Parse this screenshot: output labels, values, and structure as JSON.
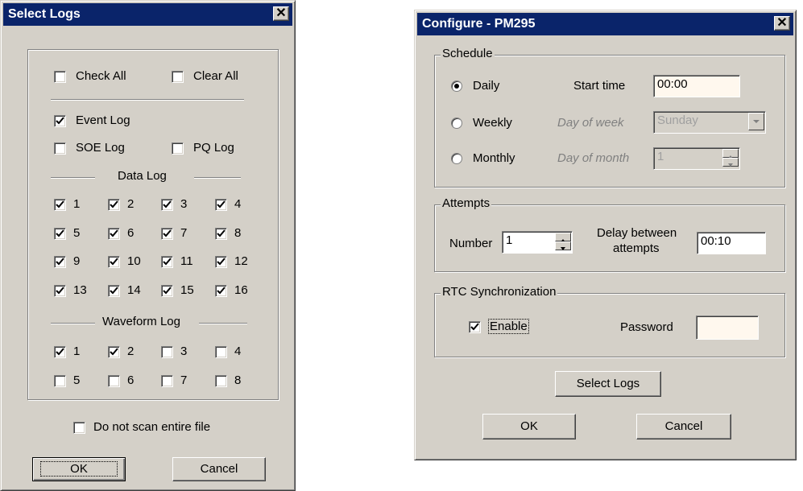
{
  "select_logs": {
    "title": "Select Logs",
    "check_all": {
      "label": "Check All",
      "checked": false
    },
    "clear_all": {
      "label": "Clear All",
      "checked": false
    },
    "event_log": {
      "label": "Event Log",
      "checked": true
    },
    "soe_log": {
      "label": "SOE Log",
      "checked": false
    },
    "pq_log": {
      "label": "PQ Log",
      "checked": false
    },
    "data_log_label": "Data Log",
    "data_logs": [
      {
        "label": "1",
        "checked": true
      },
      {
        "label": "2",
        "checked": true
      },
      {
        "label": "3",
        "checked": true
      },
      {
        "label": "4",
        "checked": true
      },
      {
        "label": "5",
        "checked": true
      },
      {
        "label": "6",
        "checked": true
      },
      {
        "label": "7",
        "checked": true
      },
      {
        "label": "8",
        "checked": true
      },
      {
        "label": "9",
        "checked": true
      },
      {
        "label": "10",
        "checked": true
      },
      {
        "label": "11",
        "checked": true
      },
      {
        "label": "12",
        "checked": true
      },
      {
        "label": "13",
        "checked": true
      },
      {
        "label": "14",
        "checked": true
      },
      {
        "label": "15",
        "checked": true
      },
      {
        "label": "16",
        "checked": true
      }
    ],
    "waveform_log_label": "Waveform Log",
    "waveform_logs": [
      {
        "label": "1",
        "checked": true
      },
      {
        "label": "2",
        "checked": true
      },
      {
        "label": "3",
        "checked": false
      },
      {
        "label": "4",
        "checked": false
      },
      {
        "label": "5",
        "checked": false
      },
      {
        "label": "6",
        "checked": false
      },
      {
        "label": "7",
        "checked": false
      },
      {
        "label": "8",
        "checked": false
      }
    ],
    "no_scan": {
      "label": "Do not scan entire file",
      "checked": false
    },
    "ok_label": "OK",
    "cancel_label": "Cancel"
  },
  "configure": {
    "title": "Configure - PM295",
    "schedule": {
      "group_label": "Schedule",
      "daily_label": "Daily",
      "weekly_label": "Weekly",
      "monthly_label": "Monthly",
      "selected": "Daily",
      "start_time_label": "Start time",
      "start_time_value": "00:00",
      "day_of_week_label": "Day of week",
      "day_of_week_value": "Sunday",
      "day_of_month_label": "Day of month",
      "day_of_month_value": "1"
    },
    "attempts": {
      "group_label": "Attempts",
      "number_label": "Number",
      "number_value": "1",
      "delay_label_line1": "Delay between",
      "delay_label_line2": "attempts",
      "delay_value": "00:10"
    },
    "rtc": {
      "group_label": "RTC Synchronization",
      "enable_label": "Enable",
      "enable_checked": true,
      "password_label": "Password",
      "password_value": ""
    },
    "select_logs_label": "Select Logs",
    "ok_label": "OK",
    "cancel_label": "Cancel"
  }
}
